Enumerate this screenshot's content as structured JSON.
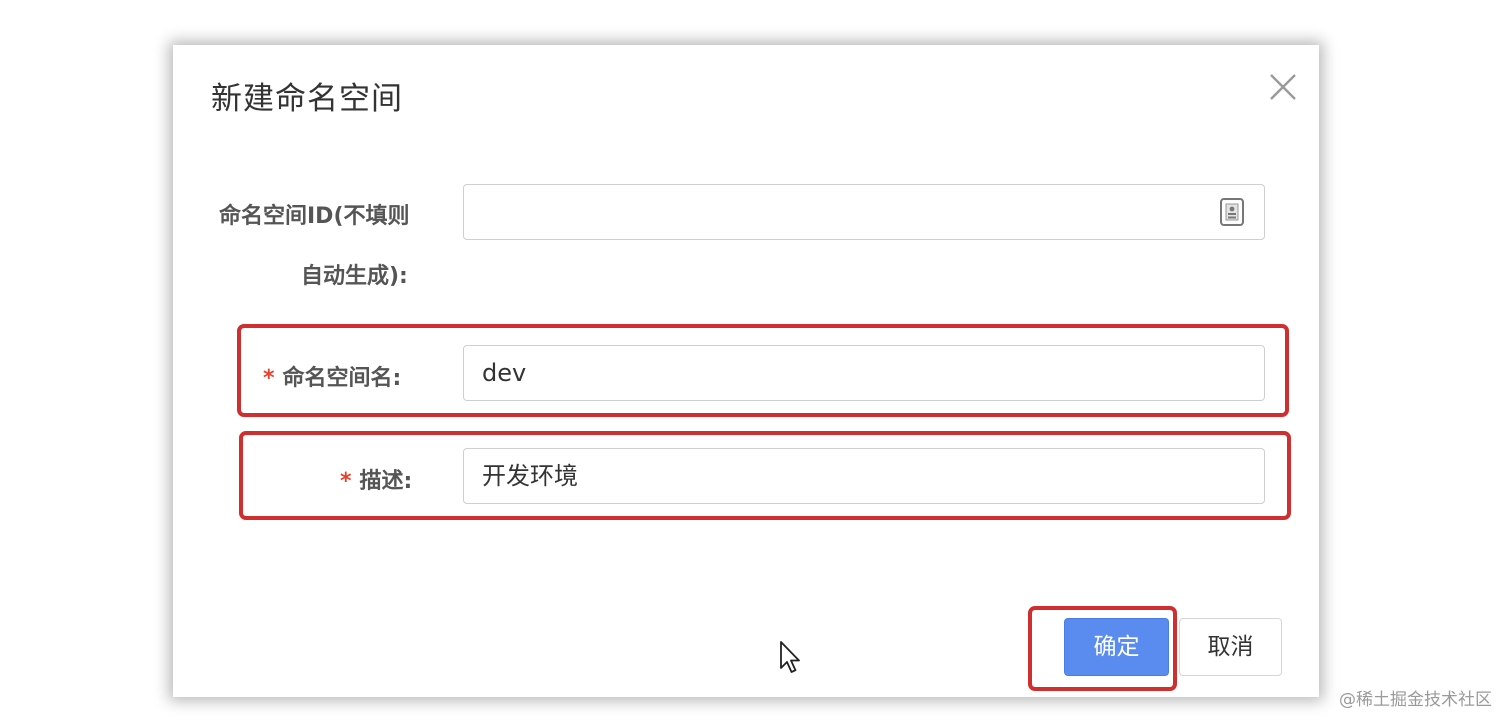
{
  "dialog": {
    "title": "新建命名空间",
    "close_icon": "close-icon"
  },
  "form": {
    "namespace_id": {
      "label_line1": "命名空间ID(不填则",
      "label_line2": "自动生成):",
      "value": "",
      "icon": "id-card-icon"
    },
    "namespace_name": {
      "required_mark": "*",
      "label": "命名空间名:",
      "value": "dev"
    },
    "description": {
      "required_mark": "*",
      "label": "描述:",
      "value": "开发环境"
    }
  },
  "footer": {
    "confirm_label": "确定",
    "cancel_label": "取消"
  },
  "watermark": "@稀土掘金技术社区",
  "colors": {
    "primary": "#5a8cf0",
    "required": "#e5412d",
    "highlight": "#cf2f2f"
  }
}
